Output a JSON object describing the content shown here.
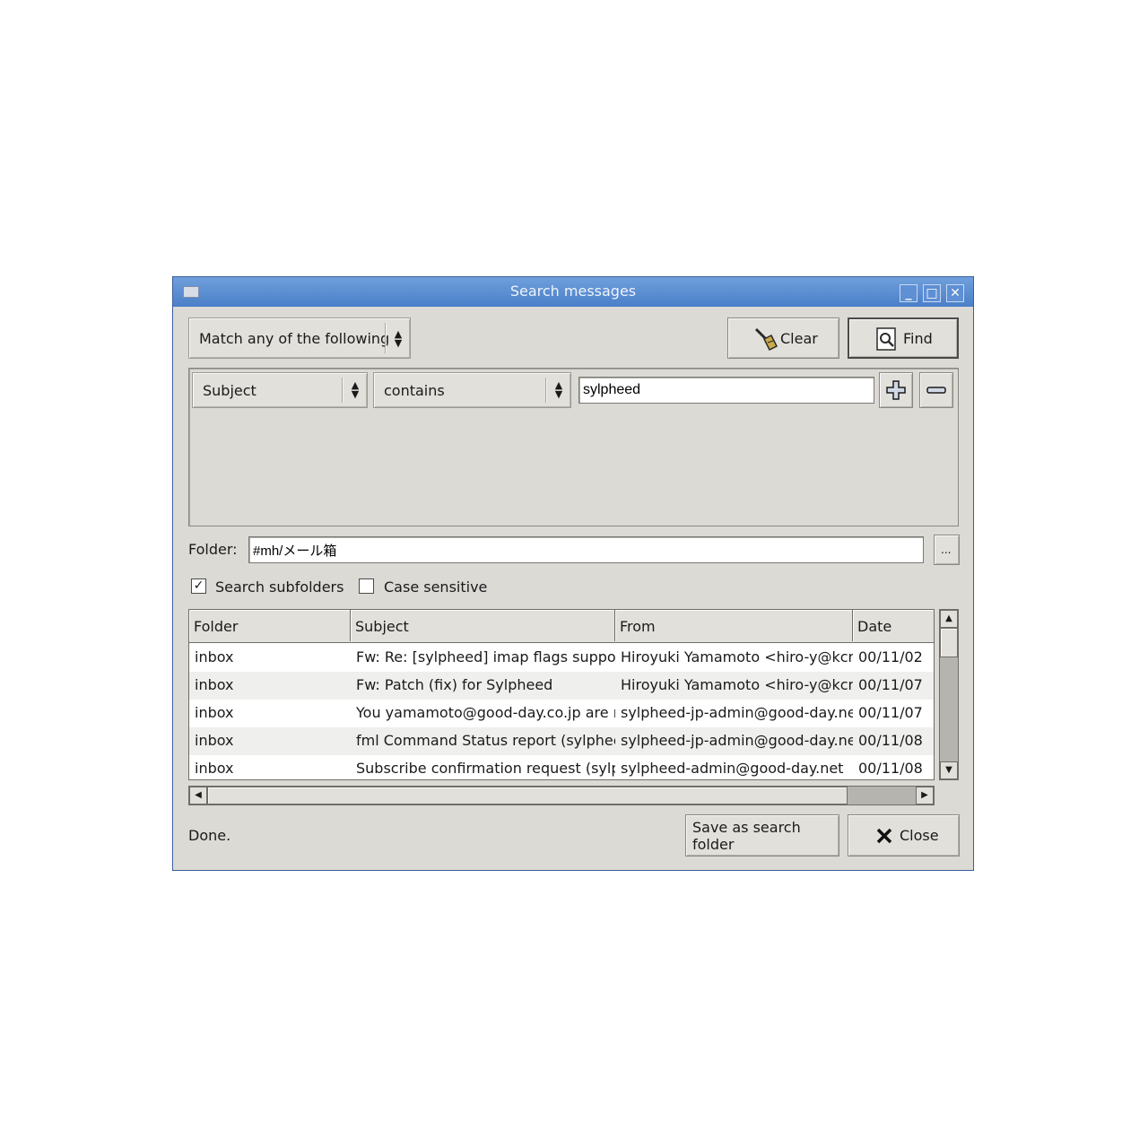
{
  "window": {
    "title": "Search messages"
  },
  "match_combo": {
    "label": "Match any of the following"
  },
  "toolbar": {
    "clear_label": "Clear",
    "find_label": "Find"
  },
  "condition": {
    "field": "Subject",
    "operator": "contains",
    "value": "sylpheed",
    "add_icon": "plus-icon",
    "remove_icon": "minus-icon"
  },
  "folder": {
    "label": "Folder:",
    "value": "#mh/メール箱",
    "browse_label": "..."
  },
  "options": {
    "search_subfolders": {
      "label": "Search subfolders",
      "checked": true
    },
    "case_sensitive": {
      "label": "Case sensitive",
      "checked": false
    }
  },
  "results": {
    "columns": [
      "Folder",
      "Subject",
      "From",
      "Date"
    ],
    "rows": [
      {
        "folder": "inbox",
        "subject": "Fw: Re: [sylpheed] imap flags support",
        "from": "Hiroyuki Yamamoto <hiro-y@kcn.",
        "date": "00/11/02"
      },
      {
        "folder": "inbox",
        "subject": "Fw: Patch (fix) for Sylpheed",
        "from": "Hiroyuki Yamamoto <hiro-y@kcn.",
        "date": "00/11/07"
      },
      {
        "folder": "inbox",
        "subject": "You yamamoto@good-day.co.jp are n",
        "from": "sylpheed-jp-admin@good-day.net",
        "date": "00/11/07"
      },
      {
        "folder": "inbox",
        "subject": "fml Command Status report (sylpheec",
        "from": "sylpheed-jp-admin@good-day.net",
        "date": "00/11/08"
      },
      {
        "folder": "inbox",
        "subject": "Subscribe confirmation request (sylph",
        "from": "sylpheed-admin@good-day.net",
        "date": "00/11/08"
      }
    ]
  },
  "footer": {
    "status": "Done.",
    "save_folder_label": "Save as search folder",
    "close_label": "Close"
  }
}
